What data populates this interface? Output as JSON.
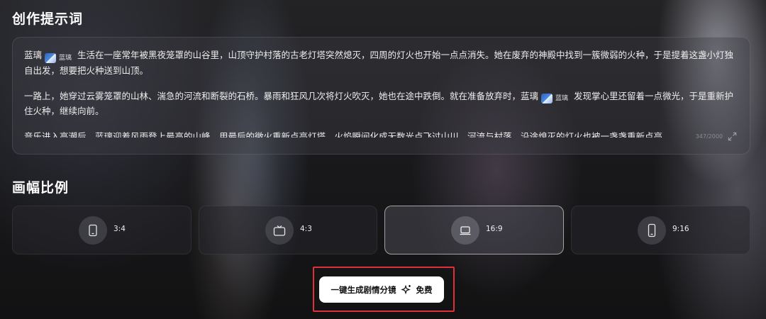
{
  "sections": {
    "prompt_title": "创作提示词",
    "ratio_title": "画幅比例"
  },
  "prompt": {
    "character_name": "蓝璃",
    "tag_label": "蓝璃",
    "p1_text": "生活在一座常年被黑夜笼罩的山谷里，山顶守护村落的古老灯塔突然熄灭，四周的灯火也开始一点点消失。她在废弃的神殿中找到一簇微弱的火种，于是提着这盏小灯独自出发，想要把火种送到山顶。",
    "p2_text_a": "一路上，她穿过云雾笼罩的山林、湍急的河流和断裂的石桥。暴雨和狂风几次将灯火吹灭，她也在途中跌倒。就在准备放弃时，",
    "p2_text_b": "发现掌心里还留着一点微光，于是重新护住火种，继续向前。",
    "p3_text": "音乐进入高潮后，蓝璃迎着风雨登上最高的山峰，用最后的微火重新点亮灯塔。火焰瞬间化成无数光点飞过山川，河流与村落，沿途熄灭的灯火也被一盏盏重新点亮。",
    "counter": "347/2000"
  },
  "ratios": [
    {
      "label": "3:4",
      "icon": "portrait-tablet-icon",
      "selected": false
    },
    {
      "label": "4:3",
      "icon": "tv-icon",
      "selected": false
    },
    {
      "label": "16:9",
      "icon": "laptop-icon",
      "selected": true
    },
    {
      "label": "9:16",
      "icon": "phone-icon",
      "selected": false
    }
  ],
  "generate": {
    "label": "一键生成剧情分镜",
    "free_label": "免费",
    "icon": "sparkle-icon"
  },
  "colors": {
    "highlight_border": "#e0303a",
    "button_bg": "#ffffff",
    "background": "#18181a"
  }
}
